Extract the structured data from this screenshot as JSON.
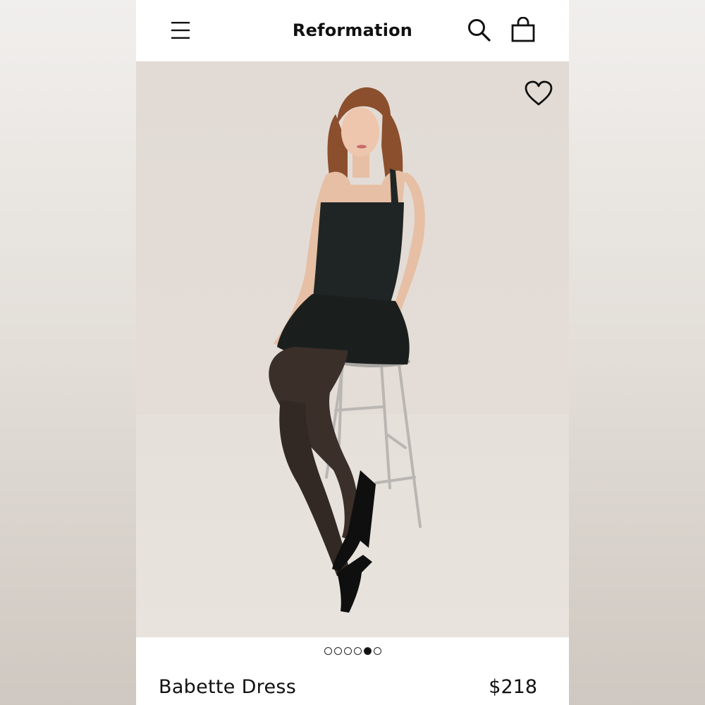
{
  "header": {
    "brand": "Reformation",
    "menu_icon": "hamburger-menu-icon",
    "search_icon": "search-icon",
    "bag_icon": "shopping-bag-icon"
  },
  "product": {
    "name": "Babette Dress",
    "price": "$218",
    "favorite_icon": "heart-icon"
  },
  "gallery": {
    "total_images": 6,
    "active_index": 4
  },
  "colors": {
    "background": "#ffffff",
    "text": "#111111",
    "photo_backdrop": "#e2dbd5"
  }
}
